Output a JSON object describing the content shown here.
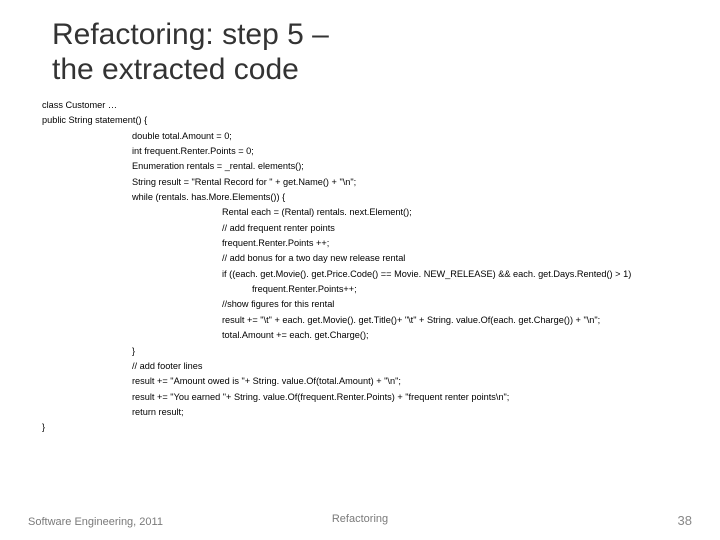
{
  "title_line1": "Refactoring: step 5 –",
  "title_line2": " the extracted code",
  "code": {
    "l01": "class Customer …",
    "l02": "public String statement() {",
    "l03": "double total.Amount = 0;",
    "l04": "int frequent.Renter.Points = 0;",
    "l05": "Enumeration rentals = _rental. elements();",
    "l06": "String result = \"Rental Record for \" +  get.Name() +  \"\\n\";",
    "l07": "while (rentals. has.More.Elements()) {",
    "l08": "Rental each = (Rental) rentals. next.Element();",
    "l09": "// add frequent renter points",
    "l10": "frequent.Renter.Points ++;",
    "l11": "// add bonus for a two day new release rental",
    "l12": "if ((each. get.Movie(). get.Price.Code() == Movie. NEW_RELEASE) &&   each. get.Days.Rented() > 1)",
    "l13": "frequent.Renter.Points++;",
    "l14": "//show figures for this rental",
    "l15": "result += \"\\t\" + each. get.Movie(). get.Title()+ \"\\t\" + String. value.Of(each. get.Charge()) + \"\\n\";",
    "l16": "total.Amount += each. get.Charge();",
    "l17": "}",
    "l18": "// add footer lines",
    "l19": "result += \"Amount owed is \"+ String. value.Of(total.Amount) + \"\\n\";",
    "l20": "result += \"You earned \"+ String. value.Of(frequent.Renter.Points) + \"frequent renter points\\n\";",
    "l21": "return result;",
    "l22": "}"
  },
  "footer": {
    "left": "Software Engineering, 2011",
    "center": "Refactoring",
    "page": "38"
  }
}
